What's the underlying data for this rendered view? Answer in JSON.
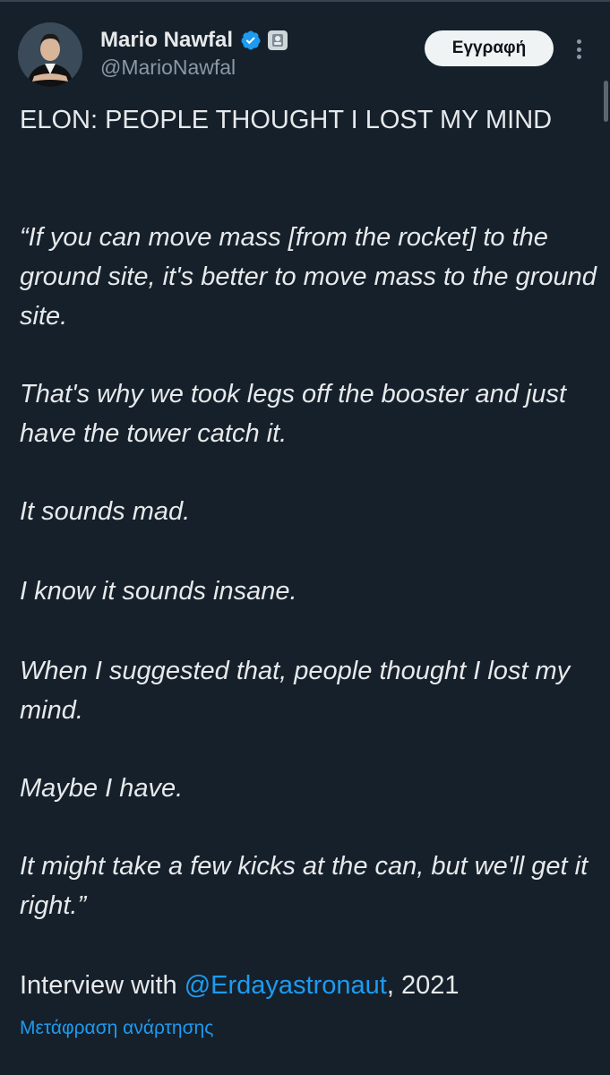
{
  "author": {
    "name": "Mario Nawfal",
    "handle": "@MarioNawfal"
  },
  "header": {
    "subscribe_label": "Εγγραφή"
  },
  "tweet": {
    "title": "ELON: PEOPLE THOUGHT I LOST MY MIND",
    "paragraphs": [
      "“If you can move mass [from the rocket] to the ground site, it's better to move mass to the ground site.",
      "That's why we took legs off the booster and just have the tower catch it.",
      "It sounds mad.",
      "I know it sounds insane.",
      "When I suggested that, people thought I lost my mind.",
      "Maybe I have.",
      "It might take a few kicks at the can, but we'll get it right.”"
    ],
    "credit_prefix": "Interview with ",
    "credit_mention": "@Erdayastronaut",
    "credit_suffix": ", 2021"
  },
  "translate_label": "Μετάφραση ανάρτησης",
  "colors": {
    "background": "#15202b",
    "text": "#e7e9ea",
    "secondary_text": "#8b98a5",
    "link": "#1d9bf0",
    "button_bg": "#eff3f4"
  },
  "icons": [
    "verified-badge-icon",
    "affiliate-badge-icon",
    "more-options-icon"
  ]
}
